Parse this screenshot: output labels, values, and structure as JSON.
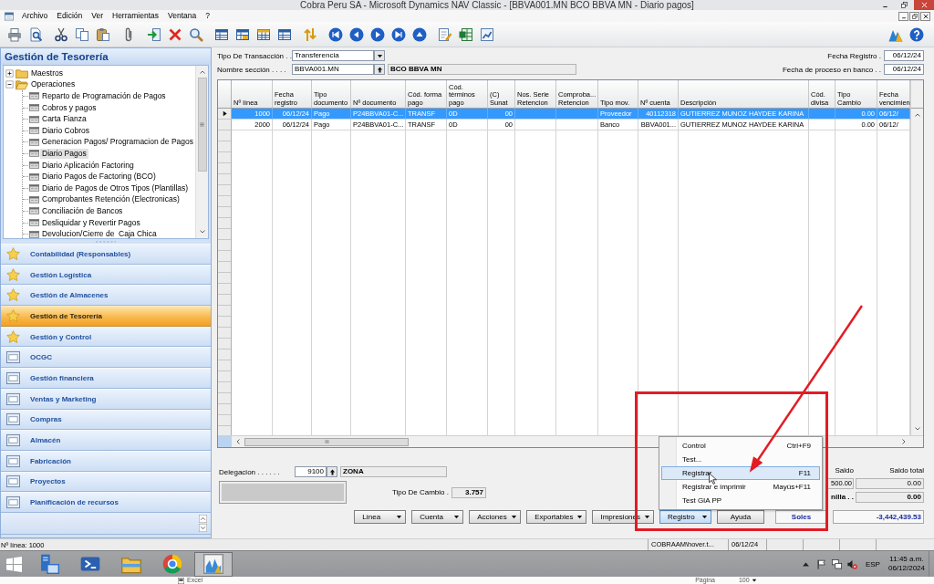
{
  "window": {
    "title": "Cobra Peru SA - Microsoft Dynamics NAV Classic - [BBVA001.MN BCO BBVA MN - Diario pagos]"
  },
  "menu_bar": [
    "Archivo",
    "Edición",
    "Ver",
    "Herramientas",
    "Ventana",
    "?"
  ],
  "navigation_pane": {
    "title": "Gestión de Tesorería",
    "tree": [
      {
        "label": "Maestros",
        "expanded": false
      },
      {
        "label": "Operaciones",
        "expanded": true,
        "children": [
          {
            "label": "Reparto de Programación de Pagos",
            "selected": false
          },
          {
            "label": "Cobros y pagos",
            "selected": false
          },
          {
            "label": "Carta Fianza",
            "selected": false
          },
          {
            "label": "Diario Cobros",
            "selected": false
          },
          {
            "label": "Generacion Pagos/ Programacion de Pagos",
            "selected": false
          },
          {
            "label": "Diario Pagos",
            "selected": true
          },
          {
            "label": "Diario Aplicación Factoring",
            "selected": false
          },
          {
            "label": "Diario Pagos de Factoring (BCO)",
            "selected": false
          },
          {
            "label": "Diario de Pagos de Otros Tipos (Plantillas)",
            "selected": false
          },
          {
            "label": "Comprobantes Retención (Electronicas)",
            "selected": false
          },
          {
            "label": "Conciliación de Bancos",
            "selected": false
          },
          {
            "label": "Desliquidar y Revertir Pagos",
            "selected": false
          },
          {
            "label": "Devolucion/Cierre de  Caja Chica",
            "selected": false
          }
        ]
      }
    ],
    "modules": [
      {
        "label": "Contabilidad (Responsables)",
        "kind": "star",
        "selected": false
      },
      {
        "label": "Gestión Logística",
        "kind": "star",
        "selected": false
      },
      {
        "label": "Gestión de Almacenes",
        "kind": "star",
        "selected": false
      },
      {
        "label": "Gestión de Tesorería",
        "kind": "star",
        "selected": true
      },
      {
        "label": "Gestión y Control",
        "kind": "star",
        "selected": false
      },
      {
        "label": "OCGC",
        "kind": "module",
        "selected": false
      },
      {
        "label": "Gestión financiera",
        "kind": "module",
        "selected": false
      },
      {
        "label": "Ventas y Marketing",
        "kind": "module",
        "selected": false
      },
      {
        "label": "Compras",
        "kind": "module",
        "selected": false
      },
      {
        "label": "Almacén",
        "kind": "module",
        "selected": false
      },
      {
        "label": "Fabricación",
        "kind": "module",
        "selected": false
      },
      {
        "label": "Proyectos",
        "kind": "module",
        "selected": false
      },
      {
        "label": "Planificación de recursos",
        "kind": "module",
        "selected": false
      }
    ]
  },
  "form": {
    "header_left": [
      {
        "label": "Tipo De Transacción . .",
        "value": "Transferencia",
        "kind": "dropdown"
      },
      {
        "label": "Nombre sección . . . .",
        "value": "BBVA001.MN",
        "kind": "lookup",
        "description": "BCO BBVA MN"
      }
    ],
    "header_right": [
      {
        "label": "Fecha Registro .",
        "value": "06/12/24"
      },
      {
        "label": "Fecha de proceso en banco . .",
        "value": "06/12/24"
      }
    ]
  },
  "journal_lines": {
    "columns": [
      "Nº línea",
      "Fecha registro",
      "Tipo documento",
      "Nº documento",
      "Cód. forma pago",
      "Cód. términos pago",
      "(C) Sunat",
      "Nos. Serie Retencion",
      "Comproba... Retencion",
      "Tipo mov.",
      "Nº cuenta",
      "Descripción",
      "Cód. divisa",
      "Tipo Cambio",
      "Fecha vencimien"
    ],
    "rows": [
      {
        "selected": true,
        "cells": [
          "1000",
          "06/12/24",
          "Pago",
          "P24BBVA01-C...",
          "TRANSF",
          "0D",
          "00",
          null,
          null,
          "Proveedor",
          "40112318",
          "GUTIERREZ MUNOZ HAYDEE KARINA",
          null,
          "0.00",
          "06/12/"
        ]
      },
      {
        "selected": false,
        "cells": [
          "2000",
          "06/12/24",
          "Pago",
          "P24BBVA01-C...",
          "TRANSF",
          "0D",
          "00",
          null,
          null,
          "Banco",
          "BBVA001...",
          "GUTIERREZ MUNOZ HAYDEE KARINA",
          null,
          "0.00",
          "06/12/"
        ]
      }
    ]
  },
  "footer": {
    "delegacion": {
      "label": "Delegacion . . . . . .",
      "value": "9100",
      "description": "ZONA"
    },
    "exchange_rate": {
      "label": "Tipo De Cambio .",
      "value": "3.757"
    },
    "balances": [
      {
        "label": "Saldo",
        "value": "500.00"
      },
      {
        "label": "Saldo total",
        "value": "0.00"
      },
      {
        "label": "nilla . .",
        "value": "0.00"
      }
    ]
  },
  "buttons": [
    {
      "label": "Línea",
      "kind": "menu",
      "selected": false
    },
    {
      "label": "Cuenta",
      "kind": "menu",
      "selected": false
    },
    {
      "label": "Acciones",
      "kind": "menu",
      "selected": false
    },
    {
      "label": "Exportables",
      "kind": "menu",
      "selected": false
    },
    {
      "label": "Impresiones",
      "kind": "menu",
      "selected": false
    },
    {
      "label": "Registro",
      "kind": "menu",
      "selected": true
    },
    {
      "label": "Ayuda",
      "kind": "plain",
      "selected": false
    }
  ],
  "currency": "Soles",
  "total": "-3,442,439.53",
  "popup_menu": [
    {
      "label": "Control",
      "shortcut": "Ctrl+F9",
      "selected": false
    },
    {
      "label": "Test...",
      "selected": false
    },
    {
      "label": "Registrar",
      "shortcut": "F11",
      "selected": true
    },
    {
      "label": "Registrar e imprimir",
      "shortcut": "Mayús+F11",
      "selected": false
    },
    {
      "label": "Test GIA PP",
      "selected": false
    }
  ],
  "status_bar": {
    "text": "Nº línea: 1000",
    "panels": [
      "COBRAAM\\hover.t...",
      "06/12/24"
    ]
  },
  "taskbar": {
    "apps": [
      {
        "kind": "server",
        "selected": false
      },
      {
        "kind": "shell",
        "selected": false
      },
      {
        "kind": "folder",
        "selected": false
      },
      {
        "kind": "browser",
        "selected": false
      },
      {
        "kind": "chart",
        "selected": true
      }
    ],
    "language": "ESP",
    "time": "11:45 a.m.",
    "date": "06/12/2024"
  },
  "background_window": {
    "tab": "Excel",
    "page_label": "Página",
    "zoom": "100"
  },
  "annotation": {
    "kind": "box_and_arrow"
  }
}
